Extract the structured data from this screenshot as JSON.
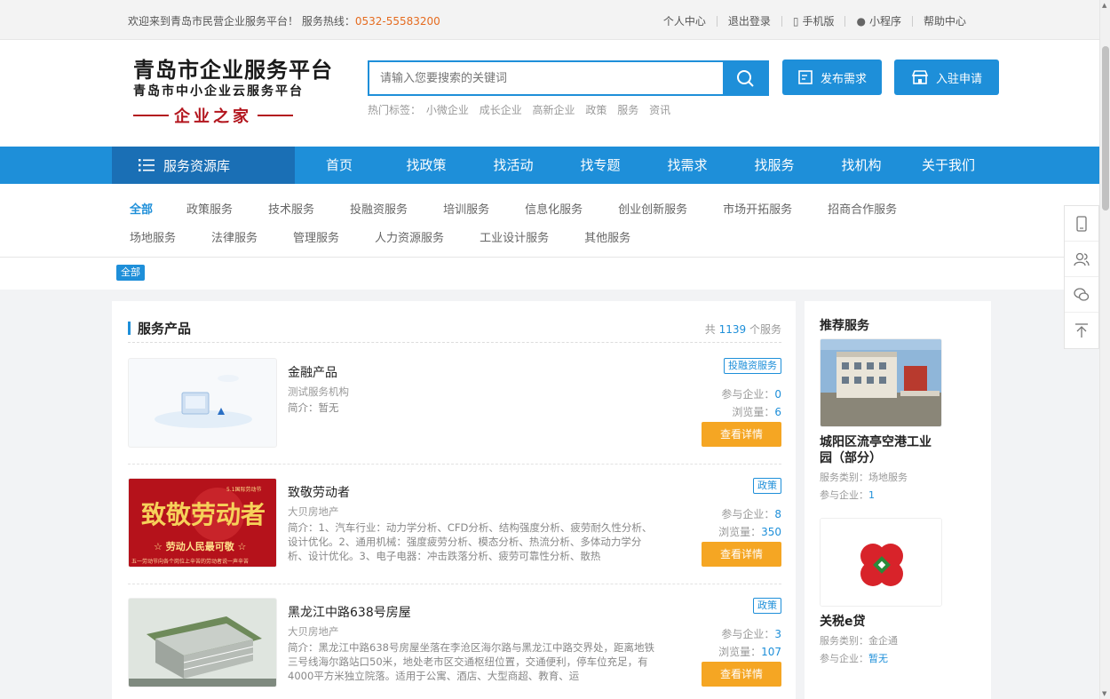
{
  "topbar": {
    "welcome": "欢迎来到青岛市民营企业服务平台！  服务热线：",
    "hotline": "0532-55583200",
    "links": [
      "个人中心",
      "退出登录",
      "手机版",
      "小程序",
      "帮助中心"
    ]
  },
  "logo": {
    "line1": "青岛市企业服务平台",
    "line2": "青岛市中小企业云服务平台",
    "line3": "企业之家"
  },
  "search": {
    "placeholder": "请输入您要搜索的关键词",
    "hot_label": "热门标签：",
    "hot_tags": [
      "小微企业",
      "成长企业",
      "高新企业",
      "政策",
      "服务",
      "资讯"
    ]
  },
  "header_buttons": {
    "publish": "发布需求",
    "join": "入驻申请"
  },
  "nav": {
    "resource": "服务资源库",
    "items": [
      "首页",
      "找政策",
      "找活动",
      "找专题",
      "找需求",
      "找服务",
      "找机构",
      "关于我们"
    ]
  },
  "filters": {
    "row1": [
      "全部",
      "政策服务",
      "技术服务",
      "投融资服务",
      "培训服务",
      "信息化服务",
      "创业创新服务",
      "市场开拓服务",
      "招商合作服务"
    ],
    "row2": [
      "场地服务",
      "法律服务",
      "管理服务",
      "人力资源服务",
      "工业设计服务",
      "其他服务"
    ]
  },
  "selected_tag": "全部",
  "products": {
    "section_title": "服务产品",
    "count_prefix": "共",
    "count": "1139",
    "count_suffix": "个服务",
    "participants_label": "参与企业：",
    "views_label": "浏览量：",
    "detail_button": "查看详情",
    "items": [
      {
        "title": "金融产品",
        "org": "测试服务机构",
        "desc": "简介：暂无",
        "tag": "投融资服务",
        "participants": "0",
        "views": "6"
      },
      {
        "title": "致敬劳动者",
        "org": "大贝房地产",
        "desc": "简介：1、汽车行业：动力学分析、CFD分析、结构强度分析、疲劳耐久性分析、设计优化。2、通用机械：强度疲劳分析、模态分析、热流分析、多体动力学分析、设计优化。3、电子电器：冲击跌落分析、疲劳可靠性分析、散热",
        "tag": "政策",
        "participants": "8",
        "views": "350",
        "banner_big": "致敬劳动者",
        "banner_sub": "☆ 劳动人民最可敬 ☆",
        "banner_small": "五一劳动节向各个岗位上辛苦的劳动者说一声辛苦",
        "banner_corner": "5.1国际劳动节"
      },
      {
        "title": "黑龙江中路638号房屋",
        "org": "大贝房地产",
        "desc": "简介：黑龙江中路638号房屋坐落在李沧区海尔路与黑龙江中路交界处，距离地铁三号线海尔路站口50米，地处老市区交通枢纽位置，交通便利，停车位充足，有4000平方米独立院落。适用于公寓、酒店、大型商超、教育、运",
        "tag": "政策",
        "participants": "3",
        "views": "107"
      }
    ]
  },
  "recommend": {
    "title": "推荐服务",
    "category_label": "服务类别：",
    "participants_label": "参与企业：",
    "items": [
      {
        "name": "城阳区流亭空港工业园（部分）",
        "category": "场地服务",
        "participants": "1"
      },
      {
        "name": "关税e贷",
        "category": "金企通",
        "participants": "暂无"
      }
    ]
  },
  "colors": {
    "primary": "#1e8fd9",
    "nav_dark": "#1a6fb5",
    "orange": "#f5a623",
    "logo_red": "#b3161e"
  }
}
